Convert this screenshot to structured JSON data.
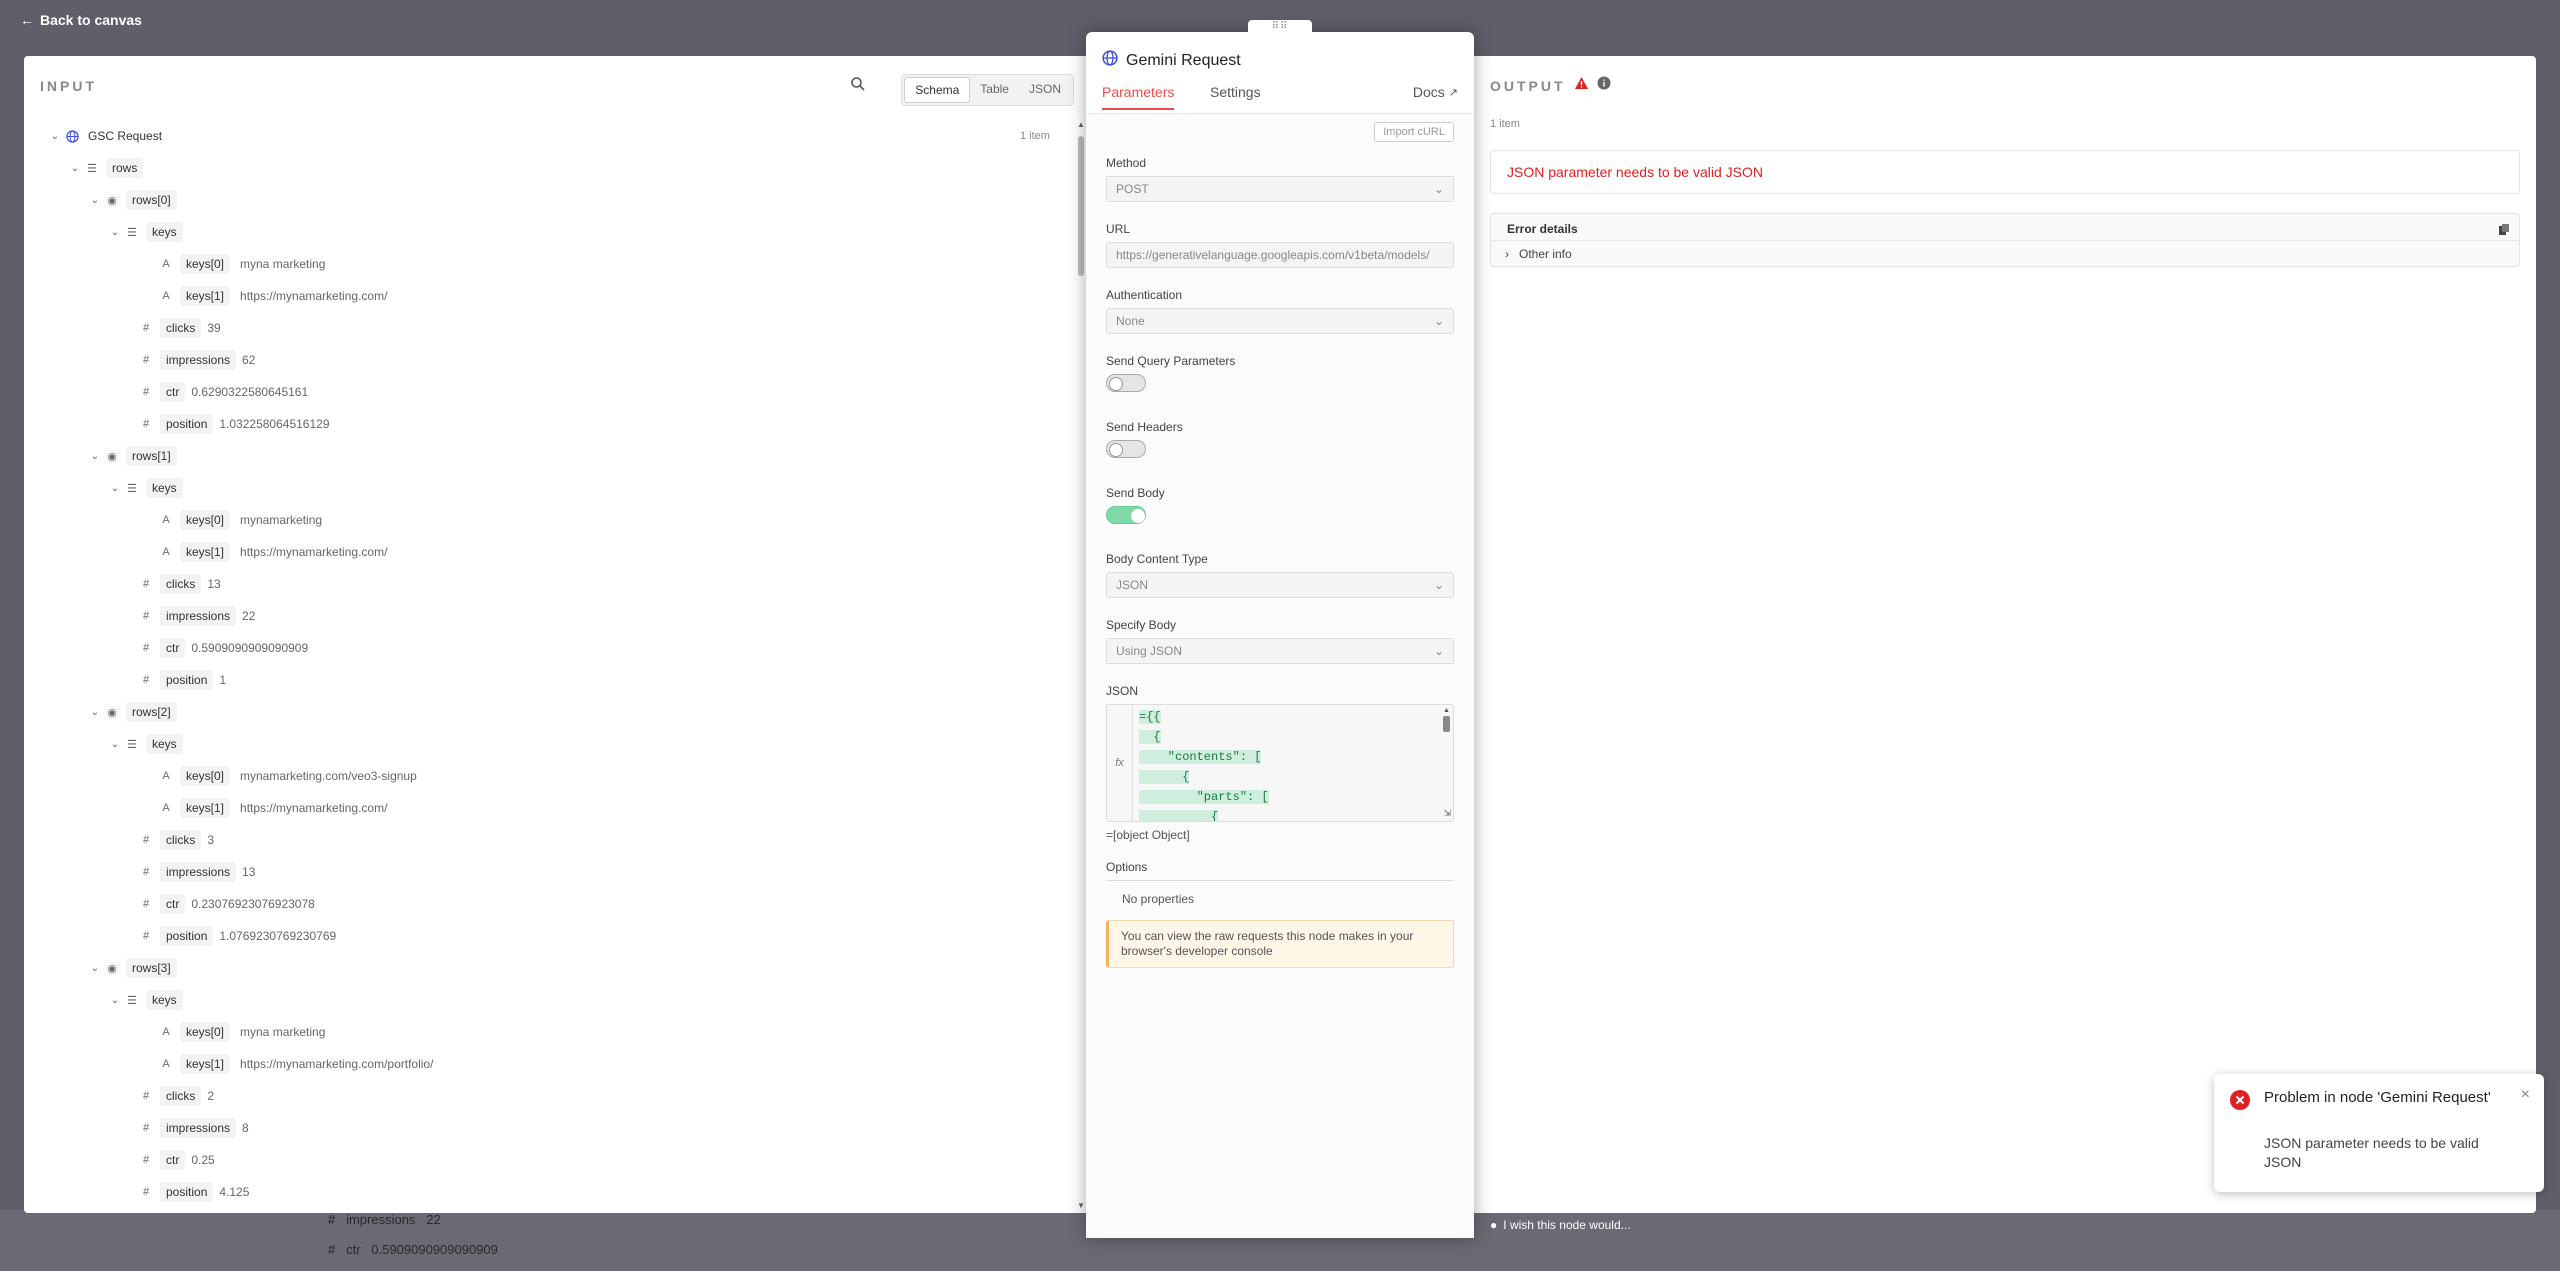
{
  "nav": {
    "back_label": "Back to canvas"
  },
  "input": {
    "title": "INPUT",
    "views": [
      "Schema",
      "Table",
      "JSON"
    ],
    "active_view": "Schema",
    "root_label": "GSC Request",
    "item_count": "1 item",
    "rows_label": "rows",
    "tree": [
      {
        "label": "rows[0]",
        "keys_label": "keys",
        "keys": [
          {
            "k": "keys[0]",
            "v": "myna marketing"
          },
          {
            "k": "keys[1]",
            "v": "https://mynamarketing.com/"
          }
        ],
        "fields": [
          {
            "k": "clicks",
            "v": "39"
          },
          {
            "k": "impressions",
            "v": "62"
          },
          {
            "k": "ctr",
            "v": "0.6290322580645161"
          },
          {
            "k": "position",
            "v": "1.032258064516129"
          }
        ]
      },
      {
        "label": "rows[1]",
        "keys_label": "keys",
        "keys": [
          {
            "k": "keys[0]",
            "v": "mynamarketing"
          },
          {
            "k": "keys[1]",
            "v": "https://mynamarketing.com/"
          }
        ],
        "fields": [
          {
            "k": "clicks",
            "v": "13"
          },
          {
            "k": "impressions",
            "v": "22"
          },
          {
            "k": "ctr",
            "v": "0.5909090909090909"
          },
          {
            "k": "position",
            "v": "1"
          }
        ]
      },
      {
        "label": "rows[2]",
        "keys_label": "keys",
        "keys": [
          {
            "k": "keys[0]",
            "v": "mynamarketing.com/veo3-signup"
          },
          {
            "k": "keys[1]",
            "v": "https://mynamarketing.com/"
          }
        ],
        "fields": [
          {
            "k": "clicks",
            "v": "3"
          },
          {
            "k": "impressions",
            "v": "13"
          },
          {
            "k": "ctr",
            "v": "0.23076923076923078"
          },
          {
            "k": "position",
            "v": "1.0769230769230769"
          }
        ]
      },
      {
        "label": "rows[3]",
        "keys_label": "keys",
        "keys": [
          {
            "k": "keys[0]",
            "v": "myna marketing"
          },
          {
            "k": "keys[1]",
            "v": "https://mynamarketing.com/portfolio/"
          }
        ],
        "fields": [
          {
            "k": "clicks",
            "v": "2"
          },
          {
            "k": "impressions",
            "v": "8"
          },
          {
            "k": "ctr",
            "v": "0.25"
          },
          {
            "k": "position",
            "v": "4.125"
          }
        ]
      }
    ]
  },
  "backdrop": {
    "impressions_label": "impressions",
    "impressions_value": "22",
    "ctr_label": "ctr",
    "ctr_value": "0.5909090909090909"
  },
  "node": {
    "title": "Gemini Request",
    "tabs": [
      "Parameters",
      "Settings"
    ],
    "active_tab": "Parameters",
    "docs_label": "Docs",
    "import_curl_label": "Import cURL",
    "method_label": "Method",
    "method_value": "POST",
    "url_label": "URL",
    "url_value": "https://generativelanguage.googleapis.com/v1beta/models/",
    "auth_label": "Authentication",
    "auth_value": "None",
    "query_label": "Send Query Parameters",
    "headers_label": "Send Headers",
    "body_label": "Send Body",
    "send_query": false,
    "send_headers": false,
    "send_body": true,
    "body_type_label": "Body Content Type",
    "body_type_value": "JSON",
    "specify_label": "Specify Body",
    "specify_value": "Using JSON",
    "json_label": "JSON",
    "json_lines": [
      "={{",
      "  {",
      "    \"contents\": [",
      "      {",
      "        \"parts\": [",
      "          {"
    ],
    "fx_label": "fx",
    "json_result": "[object Object]",
    "options_label": "Options",
    "no_props": "No properties",
    "info_text": "You can view the raw requests this node makes in your browser's developer console",
    "wish_label": "I wish this node would..."
  },
  "output": {
    "title": "OUTPUT",
    "item_count": "1 item",
    "error_message": "JSON parameter needs to be valid JSON",
    "error_details_label": "Error details",
    "other_info_label": "Other info"
  },
  "toast": {
    "title": "Problem in node 'Gemini Request'",
    "message": "JSON parameter needs to be valid JSON"
  },
  "colors": {
    "accent": "#ea4b4b",
    "error": "#e02020",
    "toggle_on": "#7fd9a6",
    "info_bg": "#fff6e8"
  }
}
